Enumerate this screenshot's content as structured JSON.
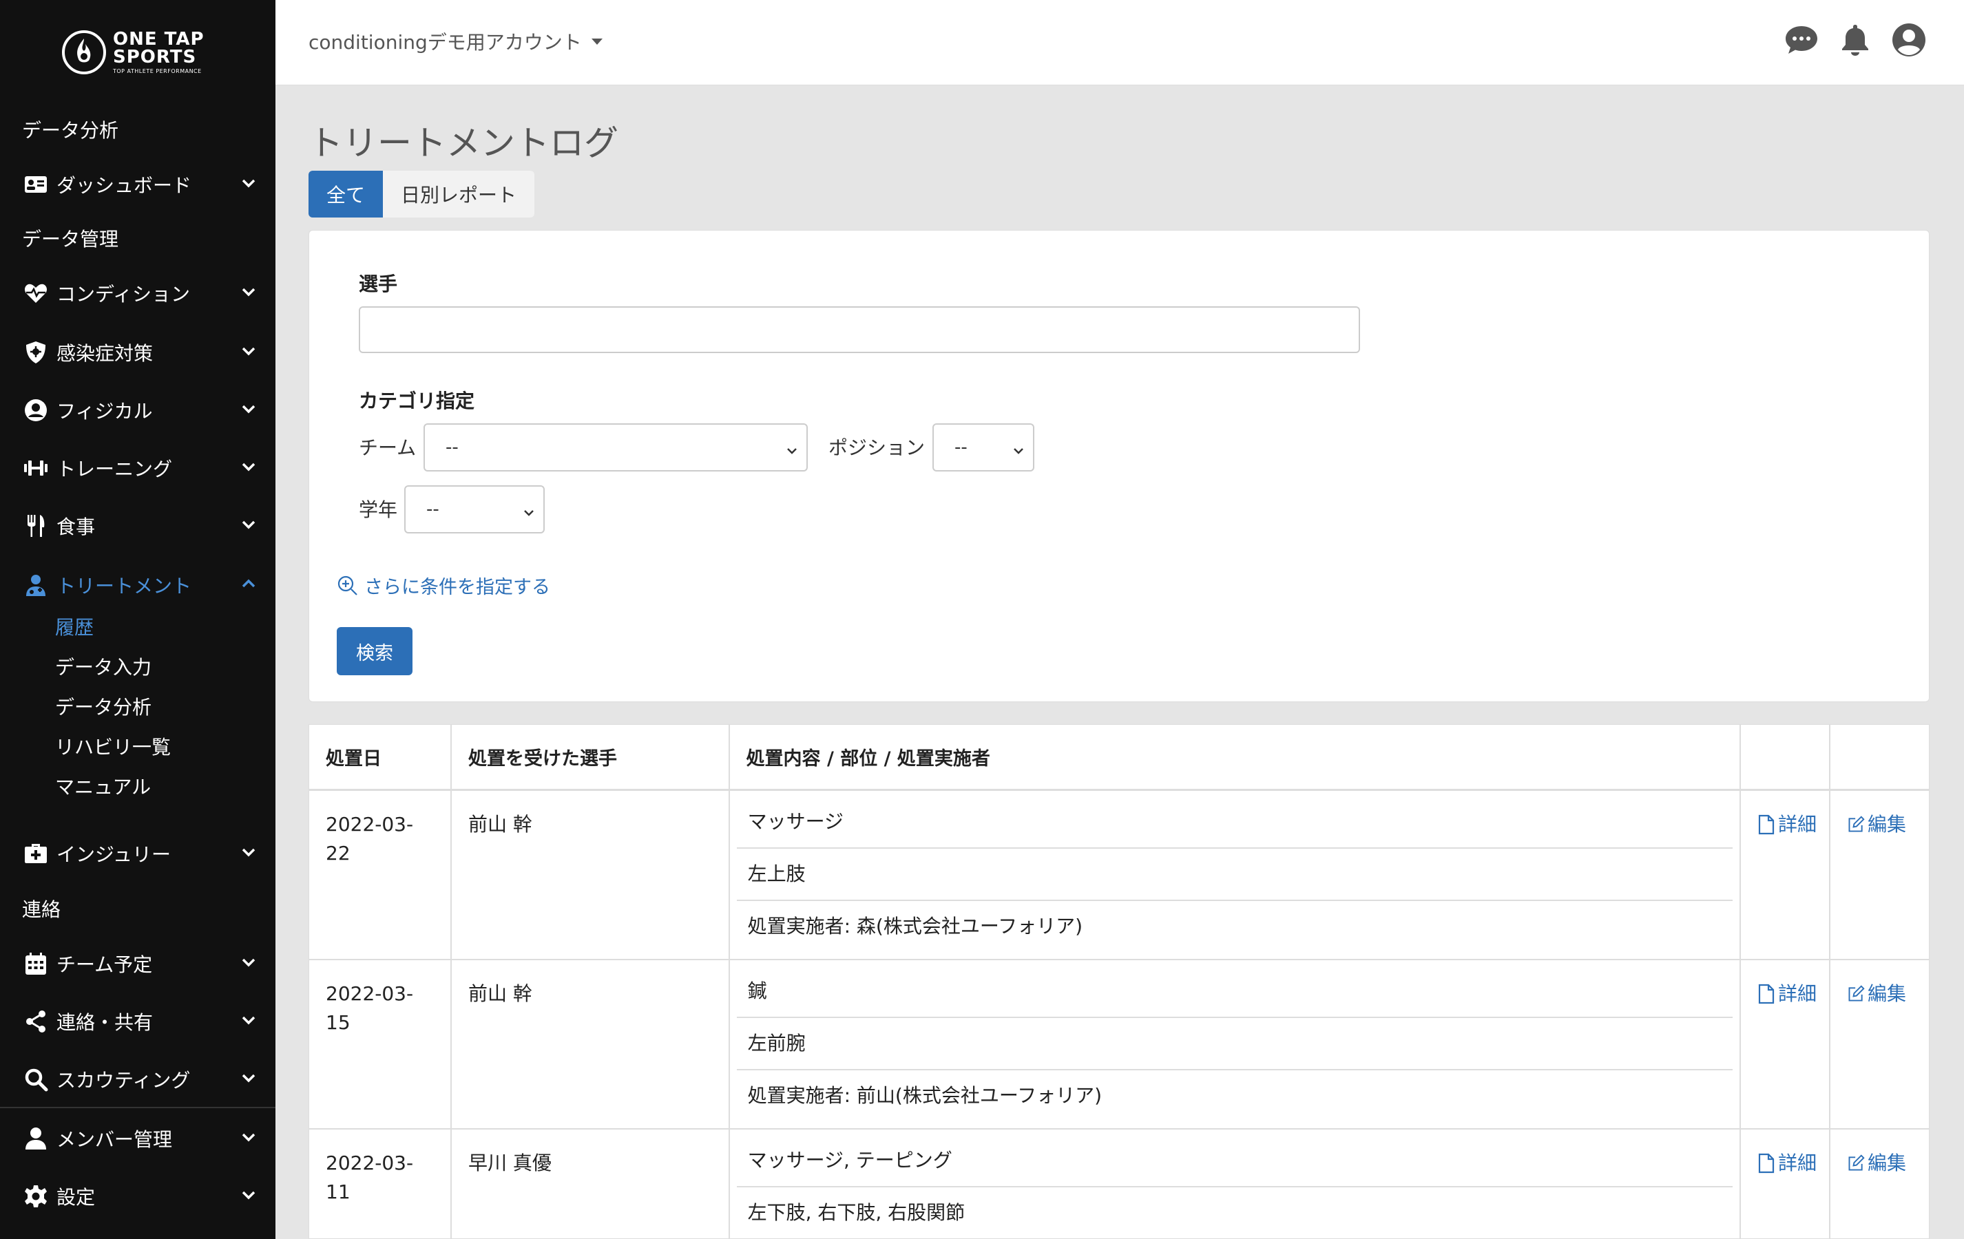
{
  "brand": {
    "line1": "ONE TAP",
    "line2": "SPORTS",
    "tagline": "TOP ATHLETE PERFORMANCE"
  },
  "sidebar": {
    "section_analysis": "データ分析",
    "dashboard": "ダッシュボード",
    "section_management": "データ管理",
    "condition": "コンディション",
    "infection": "感染症対策",
    "physical": "フィジカル",
    "training": "トレーニング",
    "meal": "食事",
    "treatment": "トリートメント",
    "treatment_sub": [
      "履歴",
      "データ入力",
      "データ分析",
      "リハビリ一覧",
      "マニュアル"
    ],
    "injury": "インジュリー",
    "section_contact": "連絡",
    "schedule": "チーム予定",
    "share": "連絡・共有",
    "scouting": "スカウティング",
    "members": "メンバー管理",
    "settings": "設定"
  },
  "topbar": {
    "account": "conditioningデモ用アカウント"
  },
  "page": {
    "title": "トリートメントログ",
    "tab_all": "全て",
    "tab_daily": "日別レポート"
  },
  "filter": {
    "player_label": "選手",
    "player_value": "",
    "category_label": "カテゴリ指定",
    "team_label": "チーム",
    "team_value": "--",
    "position_label": "ポジション",
    "position_value": "--",
    "grade_label": "学年",
    "grade_value": "--",
    "more_conditions": "さらに条件を指定する",
    "search": "検索"
  },
  "table": {
    "headers": [
      "処置日",
      "処置を受けた選手",
      "処置内容 / 部位 / 処置実施者",
      "",
      ""
    ],
    "detail_label": "詳細",
    "edit_label": "編集",
    "rows": [
      {
        "date": "2022-03-22",
        "player": "前山 幹",
        "content": "マッサージ",
        "part": "左上肢",
        "staff": "処置実施者: 森(株式会社ユーフォリア)"
      },
      {
        "date": "2022-03-15",
        "player": "前山 幹",
        "content": "鍼",
        "part": "左前腕",
        "staff": "処置実施者: 前山(株式会社ユーフォリア)"
      },
      {
        "date": "2022-03-11",
        "player": "早川 真優",
        "content": "マッサージ, テーピング",
        "part": "左下肢, 右下肢, 右股関節",
        "staff": ""
      }
    ]
  },
  "colors": {
    "accent": "#2c6fb7",
    "sidebar_bg": "#111111",
    "page_bg": "#e5e5e5"
  }
}
